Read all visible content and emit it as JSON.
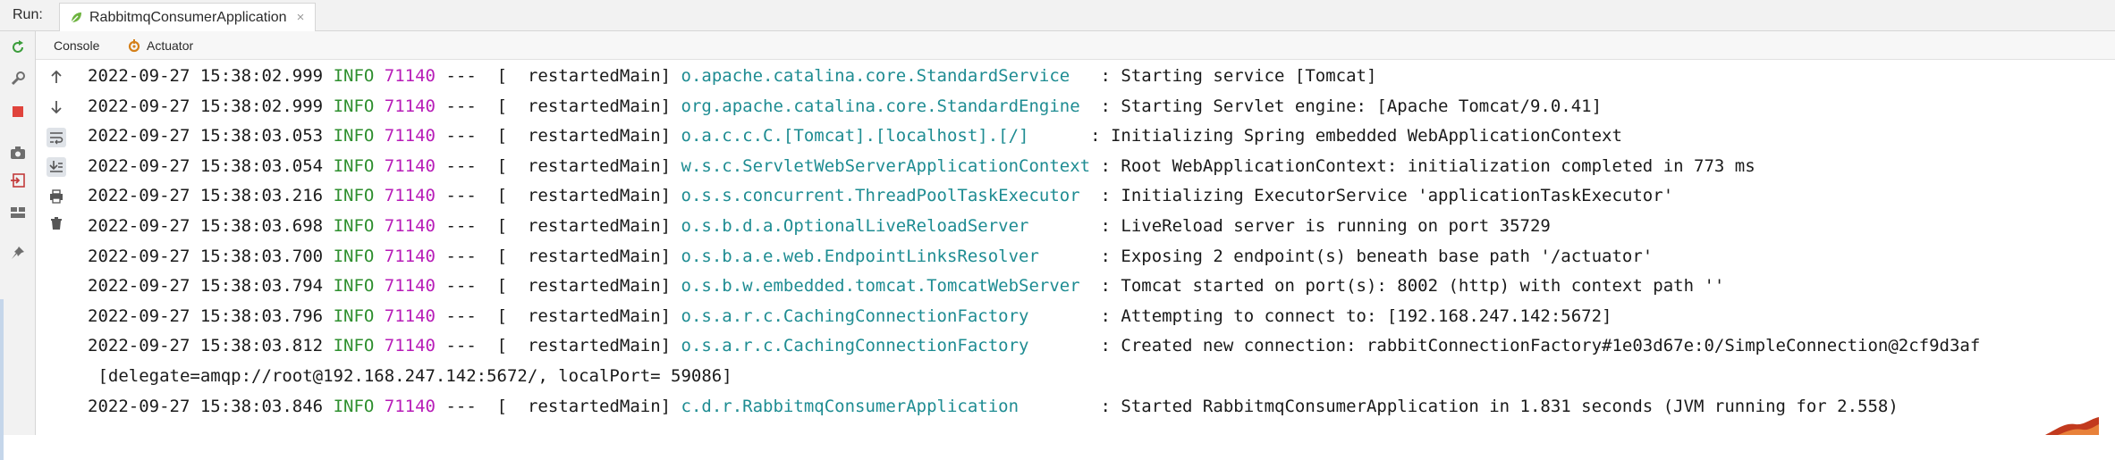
{
  "run": {
    "label": "Run:",
    "tab_title": "RabbitmqConsumerApplication",
    "close_glyph": "×"
  },
  "subtabs": {
    "console": "Console",
    "actuator": "Actuator"
  },
  "colors": {
    "info": "#2e8f2e",
    "pid": "#b81cb8",
    "logger": "#1e8c92"
  },
  "log": {
    "lines": [
      {
        "ts": "2022-09-27 15:38:02.999",
        "level": "INFO",
        "pid": "71140",
        "thread": "---  [  restartedMain] ",
        "logger": "o.apache.catalina.core.StandardService   ",
        "msg": ": Starting service [Tomcat]"
      },
      {
        "ts": "2022-09-27 15:38:02.999",
        "level": "INFO",
        "pid": "71140",
        "thread": "---  [  restartedMain] ",
        "logger": "org.apache.catalina.core.StandardEngine  ",
        "msg": ": Starting Servlet engine: [Apache Tomcat/9.0.41]"
      },
      {
        "ts": "2022-09-27 15:38:03.053",
        "level": "INFO",
        "pid": "71140",
        "thread": "---  [  restartedMain] ",
        "logger": "o.a.c.c.C.[Tomcat].[localhost].[/]      ",
        "msg": ": Initializing Spring embedded WebApplicationContext"
      },
      {
        "ts": "2022-09-27 15:38:03.054",
        "level": "INFO",
        "pid": "71140",
        "thread": "---  [  restartedMain] ",
        "logger": "w.s.c.ServletWebServerApplicationContext ",
        "msg": ": Root WebApplicationContext: initialization completed in 773 ms"
      },
      {
        "ts": "2022-09-27 15:38:03.216",
        "level": "INFO",
        "pid": "71140",
        "thread": "---  [  restartedMain] ",
        "logger": "o.s.s.concurrent.ThreadPoolTaskExecutor  ",
        "msg": ": Initializing ExecutorService 'applicationTaskExecutor'"
      },
      {
        "ts": "2022-09-27 15:38:03.698",
        "level": "INFO",
        "pid": "71140",
        "thread": "---  [  restartedMain] ",
        "logger": "o.s.b.d.a.OptionalLiveReloadServer       ",
        "msg": ": LiveReload server is running on port 35729"
      },
      {
        "ts": "2022-09-27 15:38:03.700",
        "level": "INFO",
        "pid": "71140",
        "thread": "---  [  restartedMain] ",
        "logger": "o.s.b.a.e.web.EndpointLinksResolver      ",
        "msg": ": Exposing 2 endpoint(s) beneath base path '/actuator'"
      },
      {
        "ts": "2022-09-27 15:38:03.794",
        "level": "INFO",
        "pid": "71140",
        "thread": "---  [  restartedMain] ",
        "logger": "o.s.b.w.embedded.tomcat.TomcatWebServer  ",
        "msg": ": Tomcat started on port(s): 8002 (http) with context path ''"
      },
      {
        "ts": "2022-09-27 15:38:03.796",
        "level": "INFO",
        "pid": "71140",
        "thread": "---  [  restartedMain] ",
        "logger": "o.s.a.r.c.CachingConnectionFactory       ",
        "msg": ": Attempting to connect to: [192.168.247.142:5672]"
      },
      {
        "ts": "2022-09-27 15:38:03.812",
        "level": "INFO",
        "pid": "71140",
        "thread": "---  [  restartedMain] ",
        "logger": "o.s.a.r.c.CachingConnectionFactory       ",
        "msg": ": Created new connection: rabbitConnectionFactory#1e03d67e:0/SimpleConnection@2cf9d3af"
      }
    ],
    "continuation": " [delegate=amqp://root@192.168.247.142:5672/, localPort= 59086]",
    "last": {
      "ts": "2022-09-27 15:38:03.846",
      "level": "INFO",
      "pid": "71140",
      "thread": "---  [  restartedMain] ",
      "logger": "c.d.r.RabbitmqConsumerApplication        ",
      "msg": ": Started RabbitmqConsumerApplication in 1.831 seconds (JVM running for 2.558)"
    }
  },
  "icons": {
    "left": [
      "rerun-icon",
      "settings-icon",
      "stop-icon",
      "camera-icon",
      "import-icon",
      "layout-icon",
      "pin-icon"
    ],
    "tools": [
      "arrow-up-icon",
      "arrow-down-icon",
      "soft-wrap-icon",
      "scroll-to-end-icon",
      "print-icon",
      "trash-icon"
    ]
  }
}
